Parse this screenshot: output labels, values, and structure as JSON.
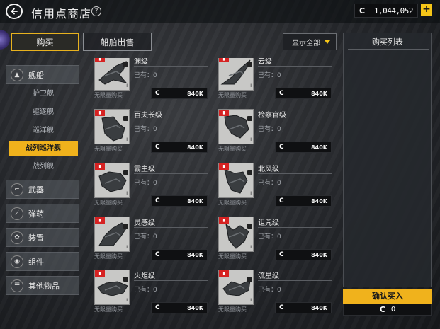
{
  "header": {
    "title": "信用点商店",
    "help_label": "?",
    "currency_symbol": "C",
    "balance": "1,044,052",
    "add_label": "+"
  },
  "tabs": {
    "buy": "购买",
    "sell": "船舶出售"
  },
  "filter": {
    "selected": "显示全部"
  },
  "sidebar": {
    "ships": {
      "label": "舰船",
      "icon": "ship-icon"
    },
    "subcategories": [
      "护卫舰",
      "驱逐舰",
      "巡洋舰",
      "战列巡洋舰",
      "战列舰"
    ],
    "active_sub": "战列巡洋舰",
    "categories": [
      {
        "label": "武器",
        "icon": "weapon-icon"
      },
      {
        "label": "弹药",
        "icon": "ammo-icon"
      },
      {
        "label": "装置",
        "icon": "device-icon"
      },
      {
        "label": "组件",
        "icon": "component-icon"
      },
      {
        "label": "其他物品",
        "icon": "misc-icon"
      }
    ]
  },
  "items": [
    {
      "name": "渊级",
      "owned": "已有：0",
      "unlimited": "无限量购买",
      "currency": "C",
      "price": "840K",
      "level": "I"
    },
    {
      "name": "云级",
      "owned": "已有：0",
      "unlimited": "无限量购买",
      "currency": "C",
      "price": "840K",
      "level": "I"
    },
    {
      "name": "百夫长级",
      "owned": "已有：0",
      "unlimited": "无限量购买",
      "currency": "C",
      "price": "840K",
      "level": "I"
    },
    {
      "name": "检察官级",
      "owned": "已有：0",
      "unlimited": "无限量购买",
      "currency": "C",
      "price": "840K",
      "level": "I"
    },
    {
      "name": "霸主级",
      "owned": "已有：0",
      "unlimited": "无限量购买",
      "currency": "C",
      "price": "840K",
      "level": "I"
    },
    {
      "name": "北风级",
      "owned": "已有：0",
      "unlimited": "无限量购买",
      "currency": "C",
      "price": "840K",
      "level": "I"
    },
    {
      "name": "灵感级",
      "owned": "已有：0",
      "unlimited": "无限量购买",
      "currency": "C",
      "price": "840K",
      "level": "I"
    },
    {
      "name": "诅咒级",
      "owned": "已有：0",
      "unlimited": "无限量购买",
      "currency": "C",
      "price": "840K",
      "level": "I"
    },
    {
      "name": "火炬级",
      "owned": "已有：0",
      "unlimited": "无限量购买",
      "currency": "C",
      "price": "840K",
      "level": "I"
    },
    {
      "name": "流星级",
      "owned": "已有：0",
      "unlimited": "无限量购买",
      "currency": "C",
      "price": "840K",
      "level": "I"
    }
  ],
  "cart": {
    "title": "购买列表",
    "confirm_label": "确认买入",
    "currency": "C",
    "total": "0"
  },
  "colors": {
    "accent": "#f0b21c",
    "badge_red": "#d62222"
  }
}
